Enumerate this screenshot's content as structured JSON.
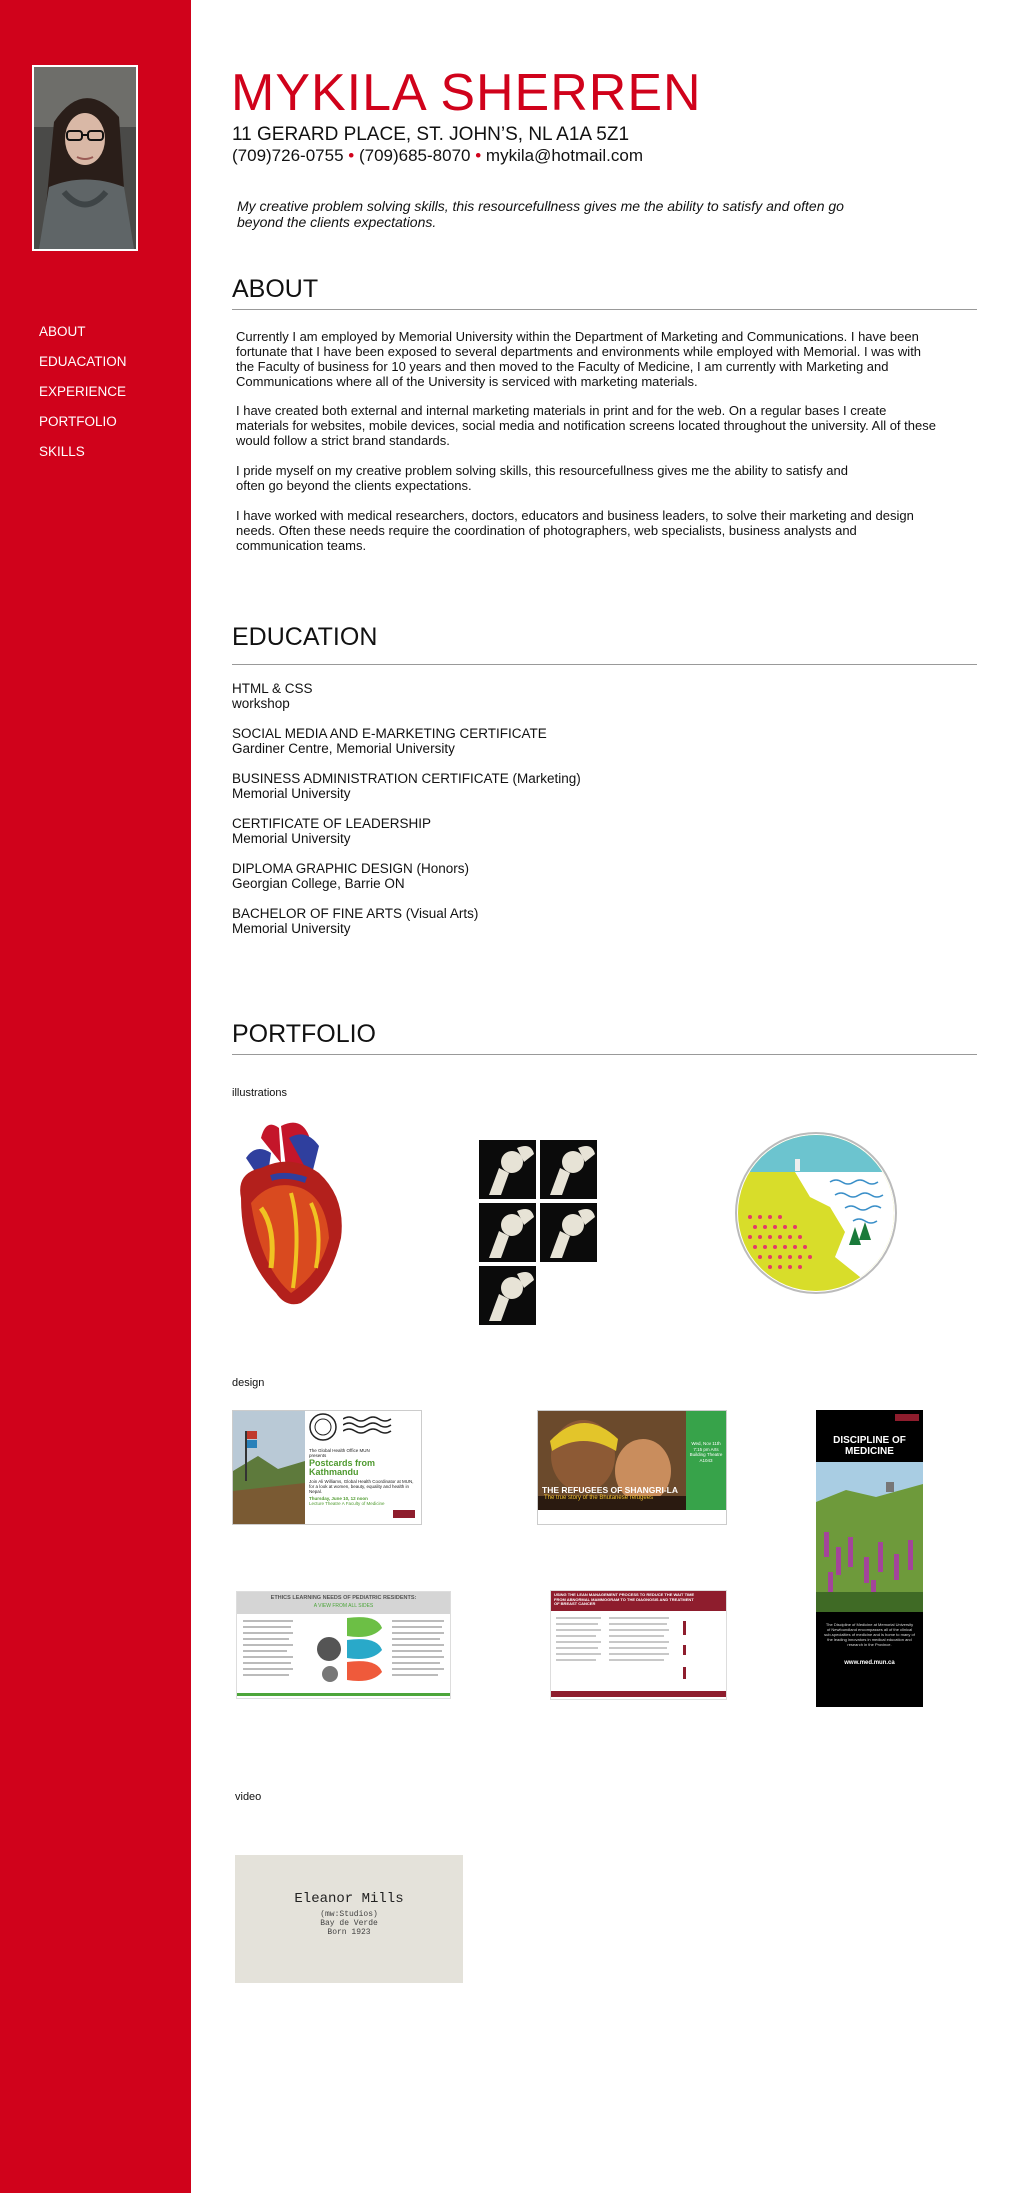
{
  "header": {
    "name": "MYKILA SHERREN",
    "address": "11 GERARD PLACE, ST. JOHN’S, NL A1A 5Z1",
    "phone1": "(709)726-0755",
    "sep1": "•",
    "phone2": "(709)685-8070",
    "sep2": "•",
    "email": "mykila@hotmail.com",
    "tagline": "My creative problem solving skills, this resourcefullness gives me the ability to satisfy and often go beyond the clients expectations."
  },
  "nav": {
    "items": [
      "ABOUT",
      "EDUACATION",
      "EXPERIENCE",
      "PORTFOLIO",
      "SKILLS"
    ]
  },
  "about": {
    "title": "ABOUT",
    "paragraphs": [
      "Currently I am employed by Memorial University within the Department of Marketing and Communications. I have been fortunate that I have been exposed to several departments and environments while employed with Memorial. I was with the Faculty of business for 10 years and then moved to the Faculty of Medicine, I am currently with Marketing and Communications where all of the University is serviced with marketing materials.",
      "I have created both external and internal marketing materials in print and for the web. On a regular bases I create materials for websites, mobile devices, social media and notification screens located throughout the university. All of these would follow a strict brand standards.",
      "I pride myself on my creative problem solving skills, this resourcefullness gives me the ability to satisfy and often go beyond the clients expectations.",
      "I have worked with medical researchers, doctors, educators and business leaders, to solve their marketing and design needs. Often these needs require the coordination of photographers, web specialists, business analysts and communication teams."
    ]
  },
  "education": {
    "title": "EDUCATION",
    "items": [
      {
        "line1": "HTML & CSS",
        "line2": "workshop"
      },
      {
        "line1": "SOCIAL MEDIA AND E-MARKETING CERTIFICATE",
        "line2": "Gardiner Centre, Memorial University"
      },
      {
        "line1": "BUSINESS ADMINISTRATION CERTIFICATE (Marketing)",
        "line2": "Memorial University"
      },
      {
        "line1": "CERTIFICATE OF LEADERSHIP",
        "line2": "Memorial University"
      },
      {
        "line1": "DIPLOMA GRAPHIC DESIGN (Honors)",
        "line2": "Georgian College, Barrie ON"
      },
      {
        "line1": "BACHELOR OF FINE ARTS (Visual Arts)",
        "line2": "Memorial University"
      }
    ]
  },
  "portfolio": {
    "title": "PORTFOLIO",
    "illustrations_label": "illustrations",
    "design_label": "design",
    "video_label": "video",
    "design1": {
      "heading1": "The Global Health Office MUN",
      "heading2": "presents",
      "title": "Postcards from Kathmandu",
      "body": "Join Ali Williams, Global Health Coordinator at MUN, for a look at women, beauty, equality and health in Nepal.",
      "date": "Thursday, June 10, 12 noon",
      "place": "Lecture Theatre A Faculty of Medicine"
    },
    "design2": {
      "side": "Wed, Nov 11th 7:15 pm Arts Building Theatre A1043",
      "title": "THE REFUGEES OF SHANGRI-LA",
      "subtitle": "The true story of the Bhutanese refugees"
    },
    "design3": {
      "title": "ETHICS LEARNING NEEDS OF PEDIATRIC RESIDENTS:",
      "subtitle": "A VIEW FROM ALL SIDES"
    },
    "design4": {
      "title": "USING THE LEAN MANAGEMENT PROCESS TO REDUCE THE WAIT TIME FROM ABNORMAL MAMMOGRAM TO THE DIAGNOSIS AND TREATMENT OF BREAST CANCER"
    },
    "design5": {
      "title": "DISCIPLINE OF MEDICINE",
      "body": "The Discipline of Medicine at Memorial University of Newfoundland encompasses all of the clinical sub-specialties of medicine and is home to many of the leading innovators in medical education and research in the Province.",
      "url": "www.med.mun.ca"
    },
    "video": {
      "title": "Eleanor Mills",
      "line2": "(mw:Studios)",
      "line3": "Bay de Verde",
      "line4": "Born 1923"
    }
  },
  "colors": {
    "accent": "#d0021b",
    "sidebar_text": "#ffffff",
    "rule": "#999999"
  },
  "icons": [
    "profile-photo",
    "heart-illustration",
    "hip-joint-illustration",
    "map-illustration"
  ]
}
